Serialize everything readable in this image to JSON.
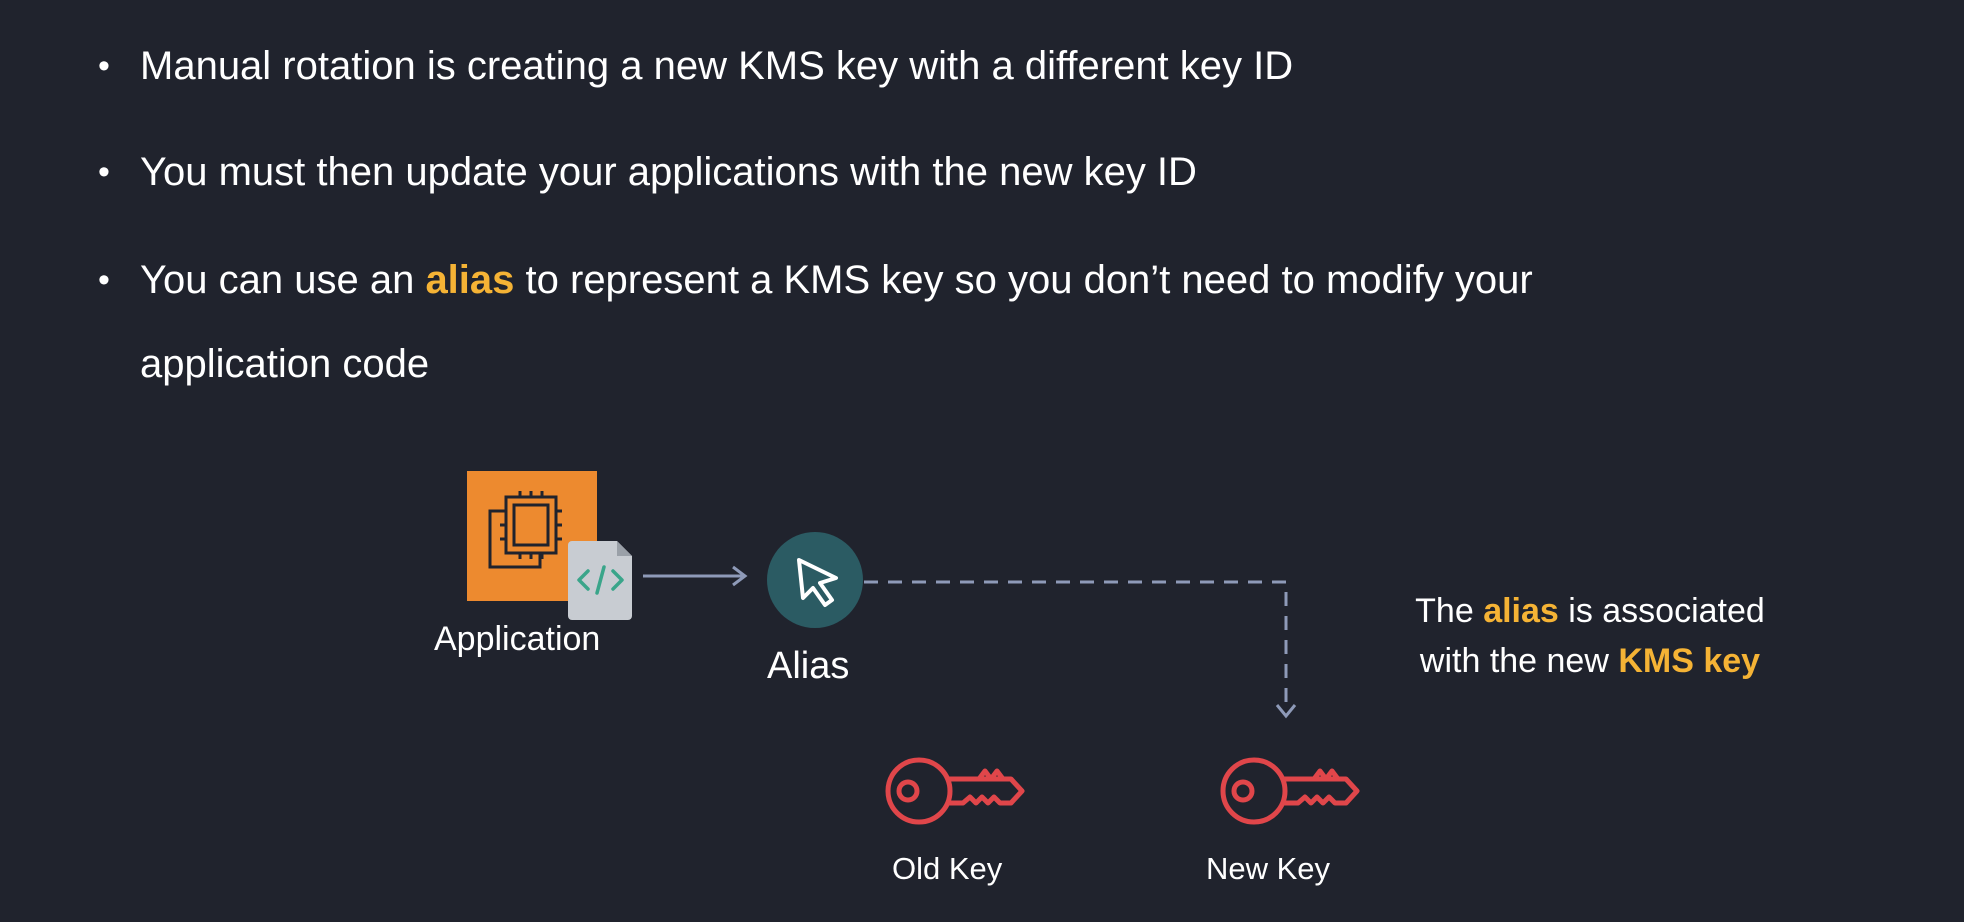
{
  "bullets": [
    {
      "text": "Manual rotation is creating a new KMS key with a different key ID"
    },
    {
      "text": "You must then update your applications with the new key ID"
    },
    {
      "pre": "You can use an ",
      "highlight": "alias",
      "post_line1": " to represent a KMS key so you don’t need to modify your",
      "post_line2": "application code"
    }
  ],
  "diagram": {
    "application_label": "Application",
    "alias_label": "Alias",
    "old_key_label": "Old Key",
    "new_key_label": "New Key",
    "note": {
      "part1": "The ",
      "highlight1": "alias",
      "part2": " is associated",
      "part3": "with the new ",
      "highlight2": "KMS key"
    },
    "icons": {
      "application": "ec2-instance-code-icon",
      "alias": "cursor-arrow-icon",
      "key": "key-icon"
    }
  },
  "colors": {
    "background": "#20232d",
    "highlight": "#f5b335",
    "aws_orange": "#ed8a2f",
    "alias_circle": "#2b5b63",
    "key_red": "#e0464a",
    "connector": "#8e9ab8"
  }
}
